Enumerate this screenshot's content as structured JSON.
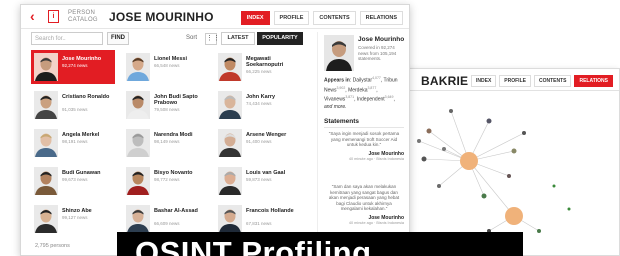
{
  "back_window": {
    "title": "BAKRIE",
    "tabs": [
      "INDEX",
      "PROFILE",
      "CONTENTS",
      "RELATIONS"
    ],
    "active_tab": "RELATIONS"
  },
  "header": {
    "back_icon": "chevron-left-icon",
    "catalog_label_1": "PERSON",
    "catalog_label_2": "CATALOG",
    "page_title": "JOSE MOURINHO",
    "tabs": [
      "INDEX",
      "PROFILE",
      "CONTENTS",
      "RELATIONS"
    ],
    "active_tab": "INDEX"
  },
  "toolbar": {
    "search_placeholder": "Search for..",
    "find_label": "FIND",
    "sort_label": "Sort",
    "latest_label": "LATEST",
    "popularity_label": "POPULARITY"
  },
  "people": [
    {
      "name": "Jose Mourinho",
      "news": "92,274 news",
      "highlighted": true,
      "skin": "#c69c7e",
      "hair": "#3a3a3a",
      "shirt": "#1d1d1d"
    },
    {
      "name": "Lionel Messi",
      "news": "66,548 news",
      "highlighted": false,
      "skin": "#d5a98a",
      "hair": "#5a3d26",
      "shirt": "#6fa8dc"
    },
    {
      "name": "Megawati Soekarnoputri",
      "news": "66,225 news",
      "highlighted": false,
      "skin": "#c08a64",
      "hair": "#222222",
      "shirt": "#c0392b"
    },
    {
      "name": "Cristiano Ronaldo",
      "news": "91,035 news",
      "highlighted": false,
      "skin": "#caa07f",
      "hair": "#222222",
      "shirt": "#444444"
    },
    {
      "name": "John Budi Sapto Prabowo",
      "news": "79,508 news",
      "highlighted": false,
      "skin": "#b98a68",
      "hair": "#222222",
      "shirt": "#eeeeee"
    },
    {
      "name": "John Karry",
      "news": "74,434 news",
      "highlighted": false,
      "skin": "#d9b59b",
      "hair": "#bbbbbb",
      "shirt": "#2c3e50"
    },
    {
      "name": "Angela Merkel",
      "news": "98,191 news",
      "highlighted": false,
      "skin": "#e2bfa6",
      "hair": "#c8a874",
      "shirt": "#4a6a8a"
    },
    {
      "name": "Narendra Modi",
      "news": "98,149 news",
      "highlighted": false,
      "skin": "#bdbdbd",
      "hair": "#9a9a9a",
      "shirt": "#cfcfcf"
    },
    {
      "name": "Arsene Wenger",
      "news": "91,400 news",
      "highlighted": false,
      "skin": "#d3ad94",
      "hair": "#dddddd",
      "shirt": "#333333"
    },
    {
      "name": "Budi Gunawan",
      "news": "99,673 news",
      "highlighted": false,
      "skin": "#b2825f",
      "hair": "#222222",
      "shirt": "#7a5a3a"
    },
    {
      "name": "Bisyo Novanto",
      "news": "98,772 news",
      "highlighted": false,
      "skin": "#b8875f",
      "hair": "#222222",
      "shirt": "#a01f1f"
    },
    {
      "name": "Louis van Gaal",
      "news": "59,873 news",
      "highlighted": false,
      "skin": "#dcae93",
      "hair": "#aaaaaa",
      "shirt": "#2a2a2a"
    },
    {
      "name": "Shinzo Abe",
      "news": "99,127 news",
      "highlighted": false,
      "skin": "#d8b292",
      "hair": "#222222",
      "shirt": "#2b2b2b"
    },
    {
      "name": "Bashar Al-Assad",
      "news": "66,609 news",
      "highlighted": false,
      "skin": "#d7b197",
      "hair": "#3a3a3a",
      "shirt": "#2d3e50"
    },
    {
      "name": "Francois Hollande",
      "news": "67,831 news",
      "highlighted": false,
      "skin": "#d5ab8f",
      "hair": "#555555",
      "shirt": "#1f2a38"
    }
  ],
  "persons_count": "2,795 persons",
  "side_panel": {
    "name": "Jose Mourinho",
    "desc": "Covered in 92,274 news from 105,194 statements.",
    "appears_label": "Appears in",
    "appears_items": [
      {
        "label": "Dailystar",
        "count": "4,077"
      },
      {
        "label": "Tribun News",
        "count": "3,902"
      },
      {
        "label": "Merdeka",
        "count": "3,877"
      },
      {
        "label": "Vivanews",
        "count": "3,871"
      },
      {
        "label": "Independent",
        "count": "3,649"
      }
    ],
    "appears_tail": "and more.",
    "statements_label": "Statements",
    "statements": [
      {
        "text": "\"Saya ingin menjadi sosok pertama yang memenangi troft Soccer Aid untuk kedua kin.\"",
        "author": "Jose Mourinho",
        "meta": "40 minute ago · Bisnis Indonesia"
      },
      {
        "text": "\"Sam dan saya akan melakukan kemitraan yang sangat bagus dan akan menjadi perasaan yang hebat bagi Claudio untuk akhirnya mengalami kekalahan.\"",
        "author": "Jose Mourinho",
        "meta": "40 minute ago · Bisnis Indonesia"
      }
    ]
  },
  "banner": {
    "text": "OSINT Profiling"
  },
  "colors": {
    "accent": "#e21d23",
    "node": "#f0b27a"
  }
}
